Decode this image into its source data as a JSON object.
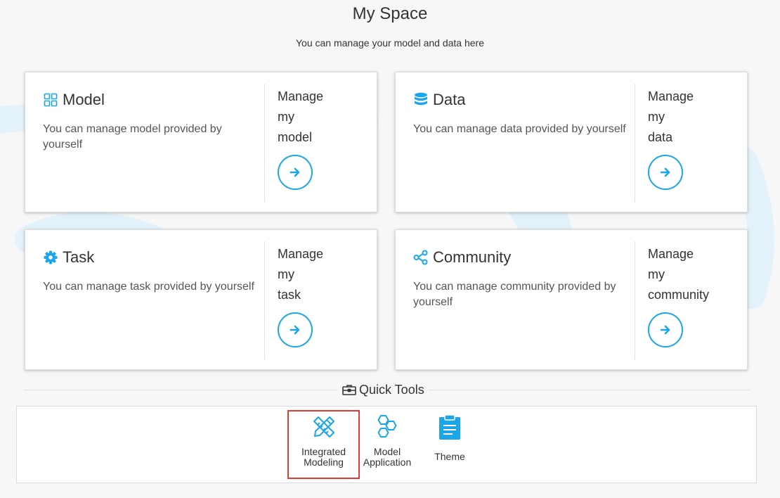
{
  "page": {
    "title": "My Space",
    "subtitle": "You can manage your model and data here"
  },
  "cards": [
    {
      "title": "Model",
      "description": "You can manage model provided by yourself",
      "icon": "grid-icon",
      "manage_lines": [
        "Manage",
        "my",
        "model"
      ]
    },
    {
      "title": "Data",
      "description": "You can manage data provided by yourself",
      "icon": "database-icon",
      "manage_lines": [
        "Manage",
        "my",
        "data"
      ]
    },
    {
      "title": "Task",
      "description": "You can manage task provided by yourself",
      "icon": "gear-icon",
      "manage_lines": [
        "Manage",
        "my",
        "task"
      ]
    },
    {
      "title": "Community",
      "description": "You can manage community provided by yourself",
      "icon": "share-nodes-icon",
      "manage_lines": [
        "Manage",
        "my",
        "community"
      ]
    }
  ],
  "quick_tools": {
    "label": "Quick Tools",
    "icon": "toolbox-icon",
    "items": [
      {
        "label_lines": [
          "Integrated",
          "Modeling"
        ],
        "icon": "pencil-ruler-icon",
        "selected": true
      },
      {
        "label_lines": [
          "Model",
          "Application"
        ],
        "icon": "hexagons-icon",
        "selected": false
      },
      {
        "label_lines": [
          "Theme"
        ],
        "icon": "clipboard-icon",
        "selected": false
      }
    ]
  },
  "colors": {
    "accent": "#1aa6e8",
    "selection": "#e53935",
    "background": "#f7f7f7"
  }
}
